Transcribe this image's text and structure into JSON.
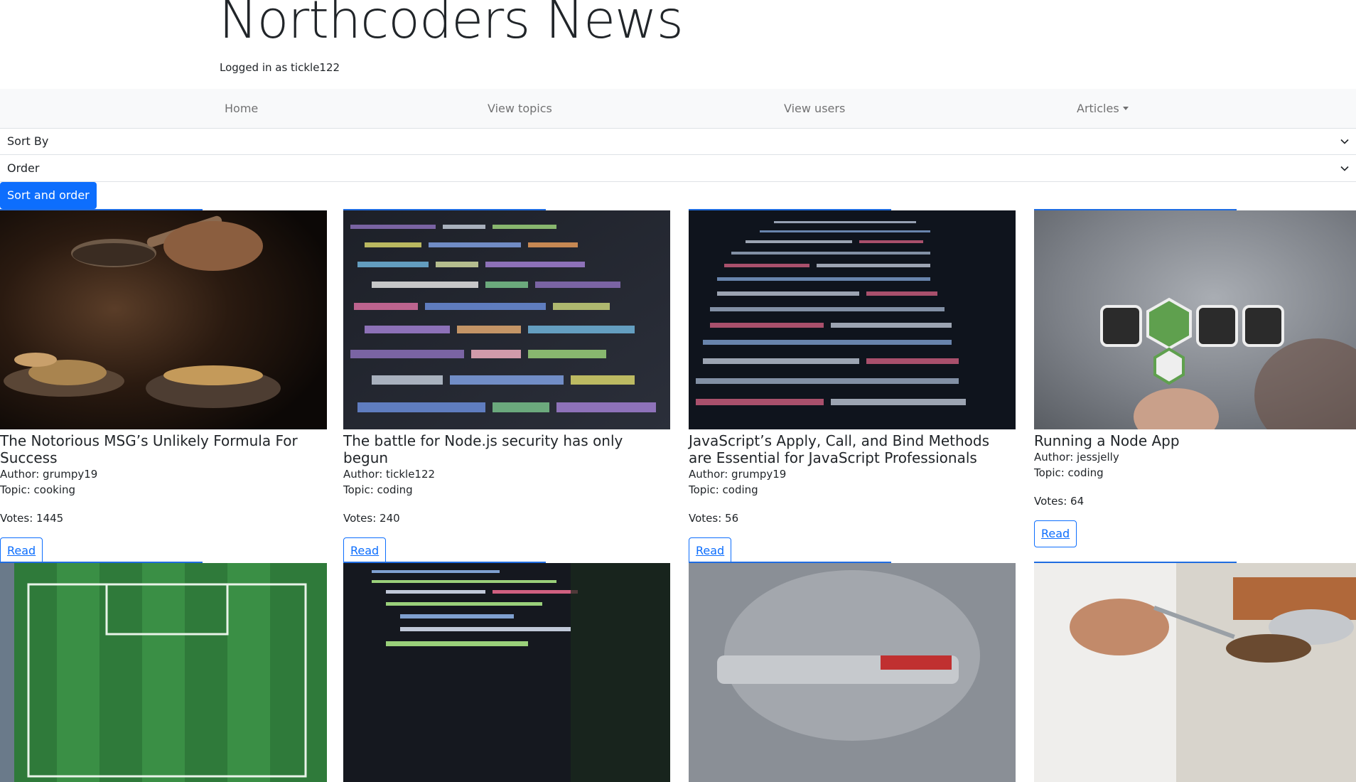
{
  "header": {
    "title": "Northcoders News",
    "login_status": "Logged in as tickle122"
  },
  "nav": {
    "home": "Home",
    "topics": "View topics",
    "users": "View users",
    "articles": "Articles"
  },
  "controls": {
    "sort_by": "Sort By",
    "order": "Order",
    "sort_button": "Sort and order"
  },
  "cards": [
    {
      "title": "The Notorious MSG’s Unlikely Formula For Success",
      "author": "Author: grumpy19",
      "topic": "Topic: cooking",
      "votes": "Votes: 1445",
      "read": "Read",
      "image": "cooking-photo"
    },
    {
      "title": "The battle for Node.js security has only begun",
      "author": "Author: tickle122",
      "topic": "Topic: coding",
      "votes": "Votes: 240",
      "read": "Read",
      "image": "code-screen-photo"
    },
    {
      "title": "JavaScript’s Apply, Call, and Bind Methods are Essential for JavaScript Professionals",
      "author": "Author: grumpy19",
      "topic": "Topic: coding",
      "votes": "Votes: 56",
      "read": "Read",
      "image": "code-screen-photo"
    },
    {
      "title": "Running a Node App",
      "author": "Author: jessjelly",
      "topic": "Topic: coding",
      "votes": "Votes: 64",
      "read": "Read",
      "image": "node-logo-photo"
    }
  ],
  "colors": {
    "primary": "#0d6efd",
    "navbar_bg": "#f8f9fa"
  }
}
